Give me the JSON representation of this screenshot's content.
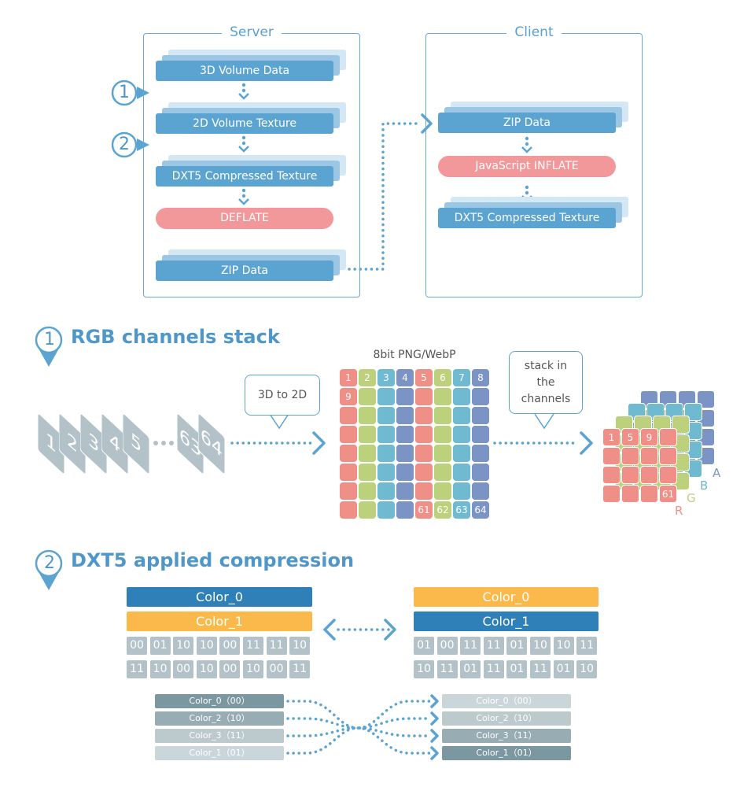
{
  "server": {
    "title": "Server",
    "steps": [
      "3D Volume Data",
      "2D Volume Texture",
      "DXT5 Compressed Texture",
      "DEFLATE",
      "ZIP Data"
    ],
    "markers": [
      "1",
      "2"
    ]
  },
  "client": {
    "title": "Client",
    "steps": [
      "ZIP Data",
      "JavaScript  INFLATE",
      "DXT5 Compressed Texture"
    ]
  },
  "section1": {
    "number": "1",
    "title": "RGB channels stack",
    "slices": [
      "1",
      "2",
      "3",
      "4",
      "5",
      "63",
      "64"
    ],
    "callout1": "3D to 2D",
    "grid_label": "8bit PNG/WebP",
    "grid_labels_top": [
      "1",
      "2",
      "3",
      "4",
      "5",
      "6",
      "7",
      "8"
    ],
    "grid_label_row2": "9",
    "grid_labels_bottom": [
      "61",
      "62",
      "63",
      "64"
    ],
    "callout2": "stack in the channels",
    "stack_labels": [
      "1",
      "5",
      "9",
      "61"
    ],
    "channels": [
      "R",
      "G",
      "B",
      "A"
    ]
  },
  "section2": {
    "number": "2",
    "title": "DXT5 applied compression",
    "left": {
      "bars": [
        "Color_0",
        "Color_1"
      ],
      "bits": [
        [
          "00",
          "01",
          "10",
          "10",
          "00",
          "11",
          "11",
          "10"
        ],
        [
          "11",
          "10",
          "00",
          "10",
          "00",
          "10",
          "00",
          "11"
        ]
      ]
    },
    "right": {
      "bars": [
        "Color_0",
        "Color_1"
      ],
      "bits": [
        [
          "01",
          "00",
          "11",
          "11",
          "01",
          "10",
          "10",
          "11"
        ],
        [
          "10",
          "11",
          "01",
          "11",
          "01",
          "11",
          "01",
          "10"
        ]
      ]
    },
    "map_left": [
      "Color_0（00）",
      "Color_2（10）",
      "Color_3（11）",
      "Color_1（01）"
    ],
    "map_right": [
      "Color_0（00）",
      "Color_2（10）",
      "Color_3（11）",
      "Color_1（01）"
    ]
  },
  "colors": {
    "accent": "#5ba4d2",
    "pink": "#f2989a",
    "dark_blue": "#2f7fb8",
    "orange": "#fcb94b",
    "red": "#ef8f87",
    "green": "#bdd17d",
    "teal": "#6fbad0",
    "purple": "#7b93c5",
    "gray": "#b2c2c8"
  }
}
